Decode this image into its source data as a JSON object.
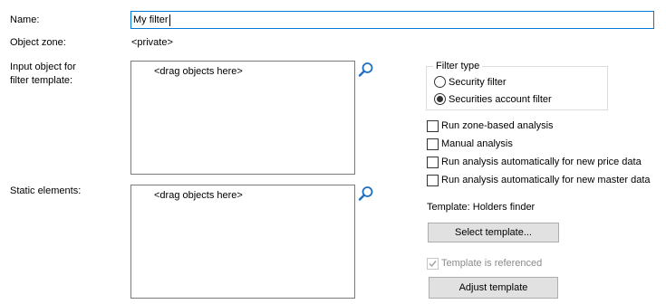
{
  "form": {
    "name_label": "Name:",
    "name_value": "My filter",
    "object_zone_label": "Object zone:",
    "object_zone_value": "<private>",
    "input_object_label_line1": "Input object for",
    "input_object_label_line2": "filter template:",
    "input_object_placeholder": "<drag objects here>",
    "static_elements_label": "Static elements:",
    "static_elements_placeholder": "<drag objects here>"
  },
  "filter_type": {
    "title": "Filter type",
    "options": [
      {
        "label": "Security filter",
        "selected": false
      },
      {
        "label": "Securities account filter",
        "selected": true
      }
    ]
  },
  "options": {
    "run_zone_based": {
      "label": "Run zone-based analysis",
      "checked": false
    },
    "manual_analysis": {
      "label": "Manual analysis",
      "checked": false
    },
    "auto_price": {
      "label": "Run analysis automatically for new price data",
      "checked": false
    },
    "auto_master": {
      "label": "Run analysis automatically for new master data",
      "checked": false
    }
  },
  "template": {
    "label": "Template: Holders finder",
    "select_button": "Select template...",
    "referenced_label": "Template is referenced",
    "referenced_checked": true,
    "adjust_button": "Adjust template"
  },
  "icons": {
    "search_input": "magnifier-icon",
    "search_static": "magnifier-icon"
  },
  "colors": {
    "focus_border": "#0078d7",
    "icon_blue": "#1e6fc1",
    "button_bg": "#e1e1e1",
    "disabled_text": "#8a8a8a"
  }
}
